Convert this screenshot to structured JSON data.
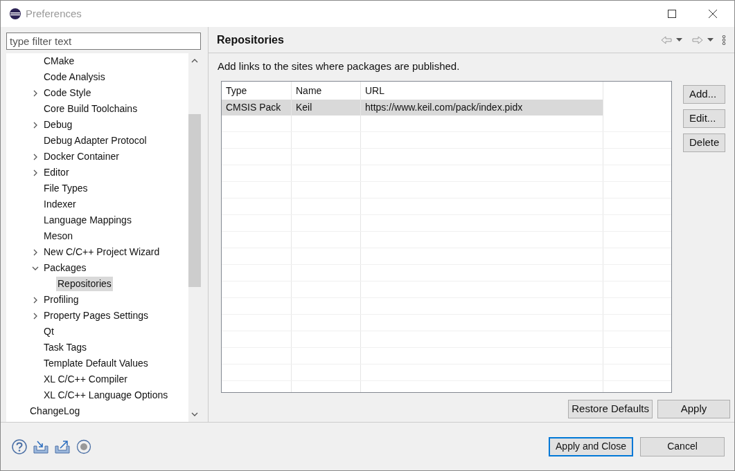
{
  "window": {
    "title": "Preferences"
  },
  "filter": {
    "placeholder": "type filter text"
  },
  "tree": {
    "nested_items": [
      {
        "label": "CMake",
        "kind": "leaf",
        "selected": false
      },
      {
        "label": "Code Analysis",
        "kind": "leaf",
        "selected": false
      },
      {
        "label": "Code Style",
        "kind": "collapsed",
        "selected": false
      },
      {
        "label": "Core Build Toolchains",
        "kind": "leaf",
        "selected": false
      },
      {
        "label": "Debug",
        "kind": "collapsed",
        "selected": false
      },
      {
        "label": "Debug Adapter Protocol",
        "kind": "leaf",
        "selected": false
      },
      {
        "label": "Docker Container",
        "kind": "collapsed",
        "selected": false
      },
      {
        "label": "Editor",
        "kind": "collapsed",
        "selected": false
      },
      {
        "label": "File Types",
        "kind": "leaf",
        "selected": false
      },
      {
        "label": "Indexer",
        "kind": "leaf",
        "selected": false
      },
      {
        "label": "Language Mappings",
        "kind": "leaf",
        "selected": false
      },
      {
        "label": "Meson",
        "kind": "leaf",
        "selected": false
      },
      {
        "label": "New C/C++ Project Wizard",
        "kind": "collapsed",
        "selected": false
      },
      {
        "label": "Packages",
        "kind": "expanded",
        "selected": false,
        "children": [
          {
            "label": "Repositories",
            "selected": true
          }
        ]
      },
      {
        "label": "Profiling",
        "kind": "collapsed",
        "selected": false
      },
      {
        "label": "Property Pages Settings",
        "kind": "collapsed",
        "selected": false
      },
      {
        "label": "Qt",
        "kind": "leaf",
        "selected": false
      },
      {
        "label": "Task Tags",
        "kind": "leaf",
        "selected": false
      },
      {
        "label": "Template Default Values",
        "kind": "leaf",
        "selected": false
      },
      {
        "label": "XL C/C++ Compiler",
        "kind": "leaf",
        "selected": false
      },
      {
        "label": "XL C/C++ Language Options",
        "kind": "leaf",
        "selected": false
      }
    ],
    "outer_items": [
      {
        "label": "ChangeLog",
        "selected": false
      }
    ]
  },
  "page": {
    "title": "Repositories",
    "description": "Add links to the sites where packages are published.",
    "table": {
      "columns": [
        "Type",
        "Name",
        "URL"
      ],
      "rows": [
        {
          "cells": [
            "CMSIS Pack",
            "Keil",
            "https://www.keil.com/pack/index.pidx"
          ],
          "selected": true
        }
      ]
    },
    "side_buttons": [
      "Add...",
      "Edit...",
      "Delete"
    ],
    "buttons": [
      "Restore Defaults",
      "Apply"
    ]
  },
  "footer": {
    "buttons": [
      {
        "label": "Apply and Close",
        "default": true
      },
      {
        "label": "Cancel",
        "default": false
      }
    ]
  }
}
